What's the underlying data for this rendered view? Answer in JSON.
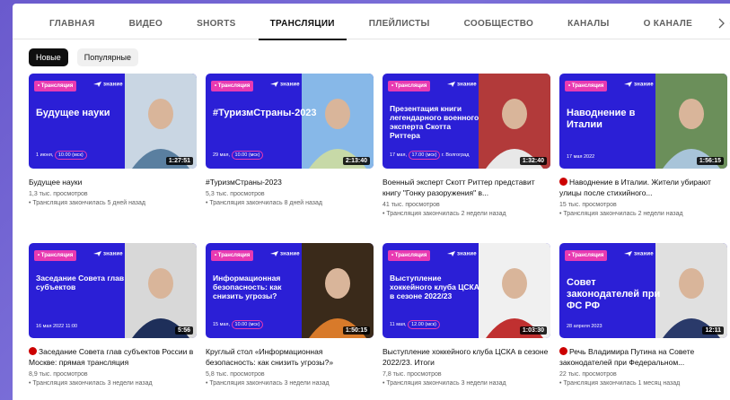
{
  "tabs": [
    "ГЛАВНАЯ",
    "ВИДЕО",
    "SHORTS",
    "ТРАНСЛЯЦИИ",
    "ПЛЕЙЛИСТЫ",
    "СООБЩЕСТВО",
    "КАНАЛЫ",
    "О КАНАЛЕ"
  ],
  "active_tab": "ТРАНСЛЯЦИИ",
  "chips": [
    "Новые",
    "Популярные"
  ],
  "thumb_common": {
    "live_tag": "• Трансляция",
    "brand": "знание"
  },
  "videos": [
    {
      "headline": "Будущее науки",
      "date": "1 июня,",
      "time": "10.00 (мск)",
      "duration": "1:27:51",
      "title": "Будущее науки",
      "views": "1,3 тыс. просмотров",
      "ago": "• Трансляция закончилась 5 дней назад",
      "live_dot": false
    },
    {
      "headline": "#ТуризмСтраны-2023",
      "date": "29 мая,",
      "time": "10.00 (мск)",
      "duration": "2:13:40",
      "title": "#ТуризмСтраны-2023",
      "views": "5,3 тыс. просмотров",
      "ago": "• Трансляция закончилась 8 дней назад",
      "live_dot": false
    },
    {
      "headline": "Презентация книги легендарного военного эксперта Скотта Риттера",
      "date": "17 мая,",
      "time": "17.00 (мск)",
      "date2": "г. Волгоград",
      "duration": "1:32:40",
      "title": "Военный эксперт Скотт Риттер представит книгу \"Гонку разоружения\" в...",
      "views": "41 тыс. просмотров",
      "ago": "• Трансляция закончилась 2 недели назад",
      "live_dot": false
    },
    {
      "headline": "Наводнение в Италии",
      "date": "17 мая 2022",
      "time": "",
      "duration": "1:56:15",
      "title": "Наводнение в Италии. Жители убирают улицы после стихийного...",
      "views": "15 тыс. просмотров",
      "ago": "• Трансляция закончилась 2 недели назад",
      "live_dot": true
    },
    {
      "headline": "Заседание Совета глав субъектов",
      "date": "16 мая 2022",
      "time": "",
      "date2": "11:00",
      "duration": "5:56",
      "title": "Заседание Совета глав субъектов России в Москве: прямая трансляция",
      "views": "8,9 тыс. просмотров",
      "ago": "• Трансляция закончилась 3 недели назад",
      "live_dot": true
    },
    {
      "headline": "Информационная безопасность: как снизить угрозы?",
      "date": "15 мая,",
      "time": "10.00 (мск)",
      "duration": "1:50:15",
      "title": "Круглый стол «Информационная безопасность: как снизить угрозы?»",
      "views": "5,8 тыс. просмотров",
      "ago": "• Трансляция закончилась 3 недели назад",
      "live_dot": false
    },
    {
      "headline": "Выступление хоккейного клуба ЦСКА в сезоне 2022/23",
      "date": "11 мая,",
      "time": "12.00 (мск)",
      "duration": "1:03:30",
      "title": "Выступление хоккейного клуба ЦСКА в сезоне 2022/23. Итоги",
      "views": "7,8 тыс. просмотров",
      "ago": "• Трансляция закончилась 3 недели назад",
      "live_dot": false
    },
    {
      "headline": "Совет законодателей при ФС РФ",
      "date": "28 апреля 2023",
      "time": "",
      "duration": "12:11",
      "title": "Речь Владимира Путина на Совете законодателей при Федеральном...",
      "views": "22 тыс. просмотров",
      "ago": "• Трансляция закончилась 1 месяц назад",
      "live_dot": true
    }
  ],
  "colors": {
    "thumb_bg": "#2b1fd6",
    "live_tag": "#e83ab2",
    "live_dot": "#cc0000"
  }
}
